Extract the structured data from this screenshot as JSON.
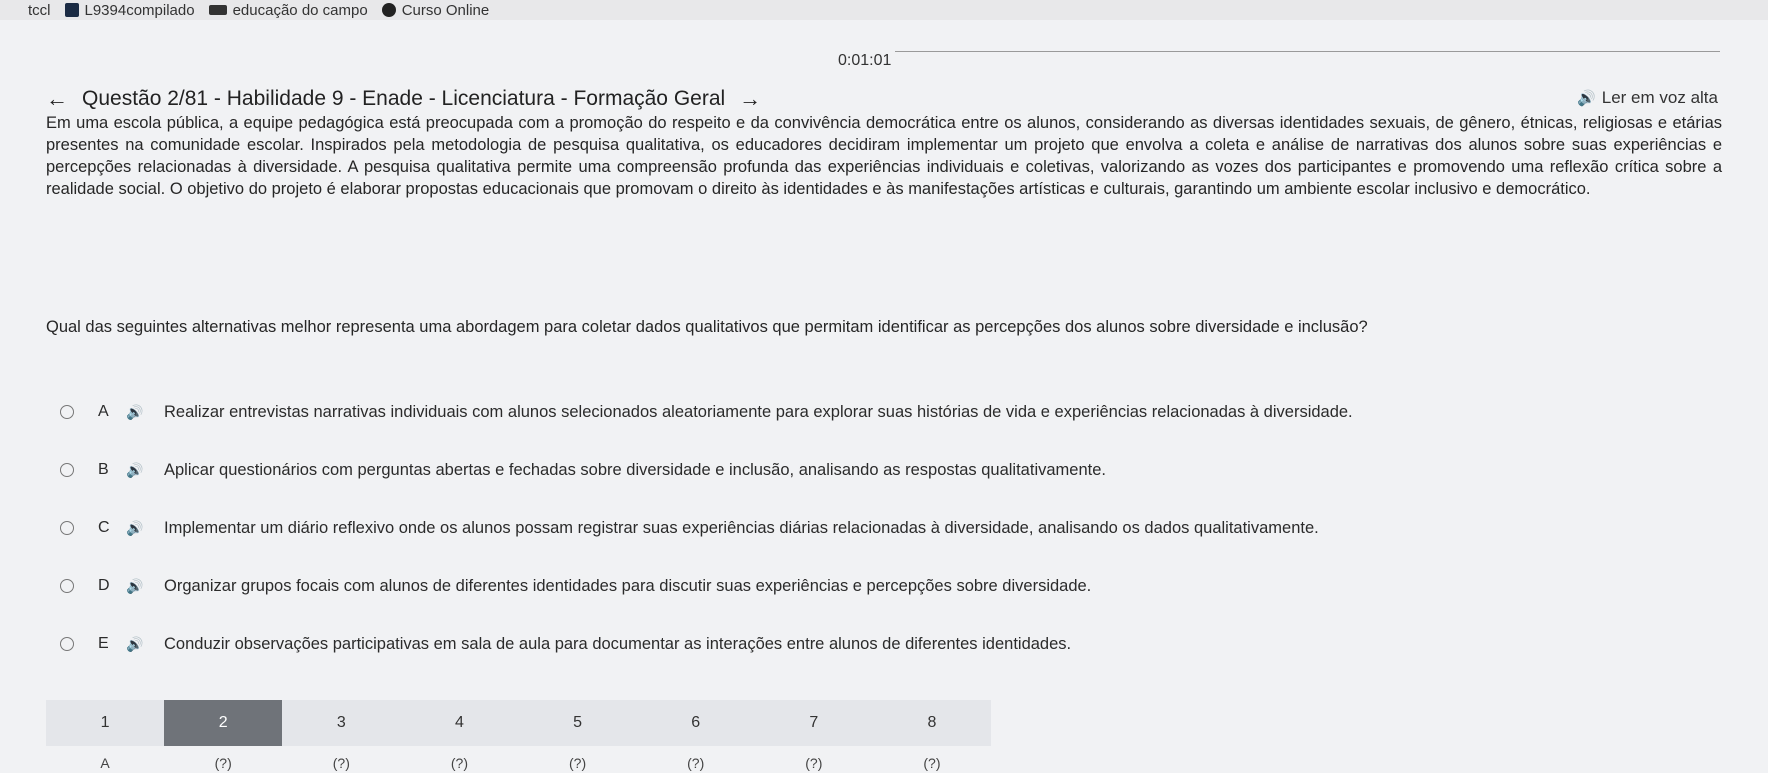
{
  "bookmarks": [
    {
      "label": "tccl",
      "icon": "file-icon"
    },
    {
      "label": "L9394compilado",
      "icon": "bookmark-icon"
    },
    {
      "label": "educação do campo",
      "icon": "logo-icon"
    },
    {
      "label": "Curso Online",
      "icon": "circle-icon"
    }
  ],
  "timer": "0:01:01",
  "header": {
    "title": "Questão 2/81 - Habilidade 9 - Enade - Licenciatura - Formação Geral",
    "read_aloud": "Ler em voz alta"
  },
  "statement": "Em uma escola pública, a equipe pedagógica está preocupada com a promoção do respeito e da convivência democrática entre os alunos, considerando as diversas identidades sexuais, de gênero, étnicas, religiosas e etárias presentes na comunidade escolar. Inspirados pela metodologia de pesquisa qualitativa, os educadores decidiram implementar um projeto que envolva a coleta e análise de narrativas dos alunos sobre suas experiências e percepções relacionadas à diversidade. A pesquisa qualitativa permite uma compreensão profunda das experiências individuais e coletivas, valorizando as vozes dos participantes e promovendo uma reflexão crítica sobre a realidade social. O objetivo do projeto é elaborar propostas educacionais que promovam o direito às identidades e às manifestações artísticas e culturais, garantindo um ambiente escolar inclusivo e democrático.",
  "question": "Qual das seguintes alternativas melhor representa uma abordagem para coletar dados qualitativos que permitam identificar as percepções dos alunos sobre diversidade e inclusão?",
  "options": [
    {
      "letter": "A",
      "text": "Realizar entrevistas narrativas individuais com alunos selecionados aleatoriamente para explorar suas histórias de vida e experiências relacionadas à diversidade."
    },
    {
      "letter": "B",
      "text": "Aplicar questionários com perguntas abertas e fechadas sobre diversidade e inclusão, analisando as respostas qualitativamente."
    },
    {
      "letter": "C",
      "text": "Implementar um diário reflexivo onde os alunos possam registrar suas experiências diárias relacionadas à diversidade, analisando os dados qualitativamente."
    },
    {
      "letter": "D",
      "text": "Organizar grupos focais com alunos de diferentes identidades para discutir suas experiências e percepções sobre diversidade."
    },
    {
      "letter": "E",
      "text": "Conduzir observações participativas em sala de aula para documentar as interações entre alunos de diferentes identidades."
    }
  ],
  "pager": {
    "pages": [
      "1",
      "2",
      "3",
      "4",
      "5",
      "6",
      "7",
      "8"
    ],
    "active_index": 1,
    "status": [
      "A",
      "(?)",
      "(?)",
      "(?)",
      "(?)",
      "(?)",
      "(?)",
      "(?)"
    ]
  }
}
